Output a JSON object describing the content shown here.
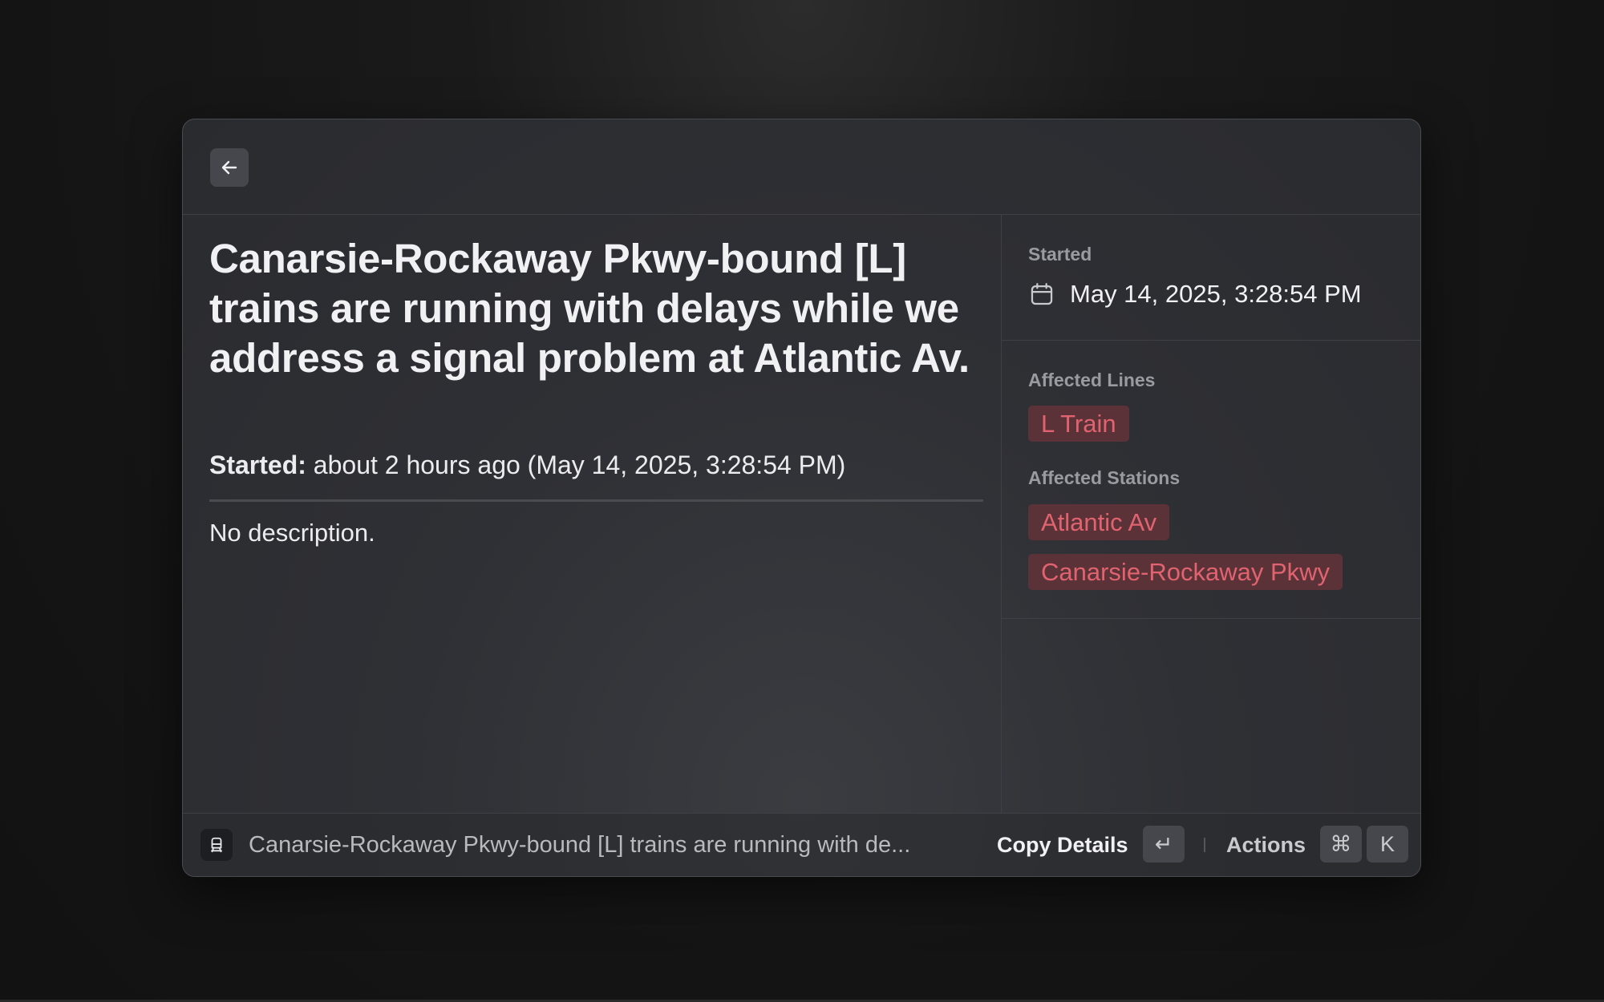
{
  "icons": {
    "back": "arrow-left-icon",
    "calendar": "calendar-icon",
    "footer": "train-icon",
    "enter": "return-key-icon",
    "command": "command-key-icon"
  },
  "colors": {
    "background": "#141414",
    "window": "#2f3035",
    "tag_bg": "#5a3238",
    "tag_text": "#e0636f",
    "label": "#9a9ba0"
  },
  "detail": {
    "title": "Canarsie-Rockaway Pkwy-bound [L] trains are running with delays while we address a signal problem at Atlantic Av.",
    "started_label": "Started:",
    "started_value": " about 2 hours ago (May 14, 2025, 3:28:54 PM)",
    "description": "No description."
  },
  "sidebar": {
    "started_label": "Started",
    "started_value": "May 14, 2025, 3:28:54 PM",
    "lines_label": "Affected Lines",
    "lines": [
      "L Train"
    ],
    "stations_label": "Affected Stations",
    "stations": [
      "Atlantic Av",
      "Canarsie-Rockaway Pkwy"
    ]
  },
  "footer": {
    "title": "Canarsie-Rockaway Pkwy-bound [L] trains are running with de...",
    "primary_action": "Copy Details",
    "enter_key": "↵",
    "actions_label": "Actions",
    "cmd_key": "⌘",
    "k_key": "K"
  }
}
